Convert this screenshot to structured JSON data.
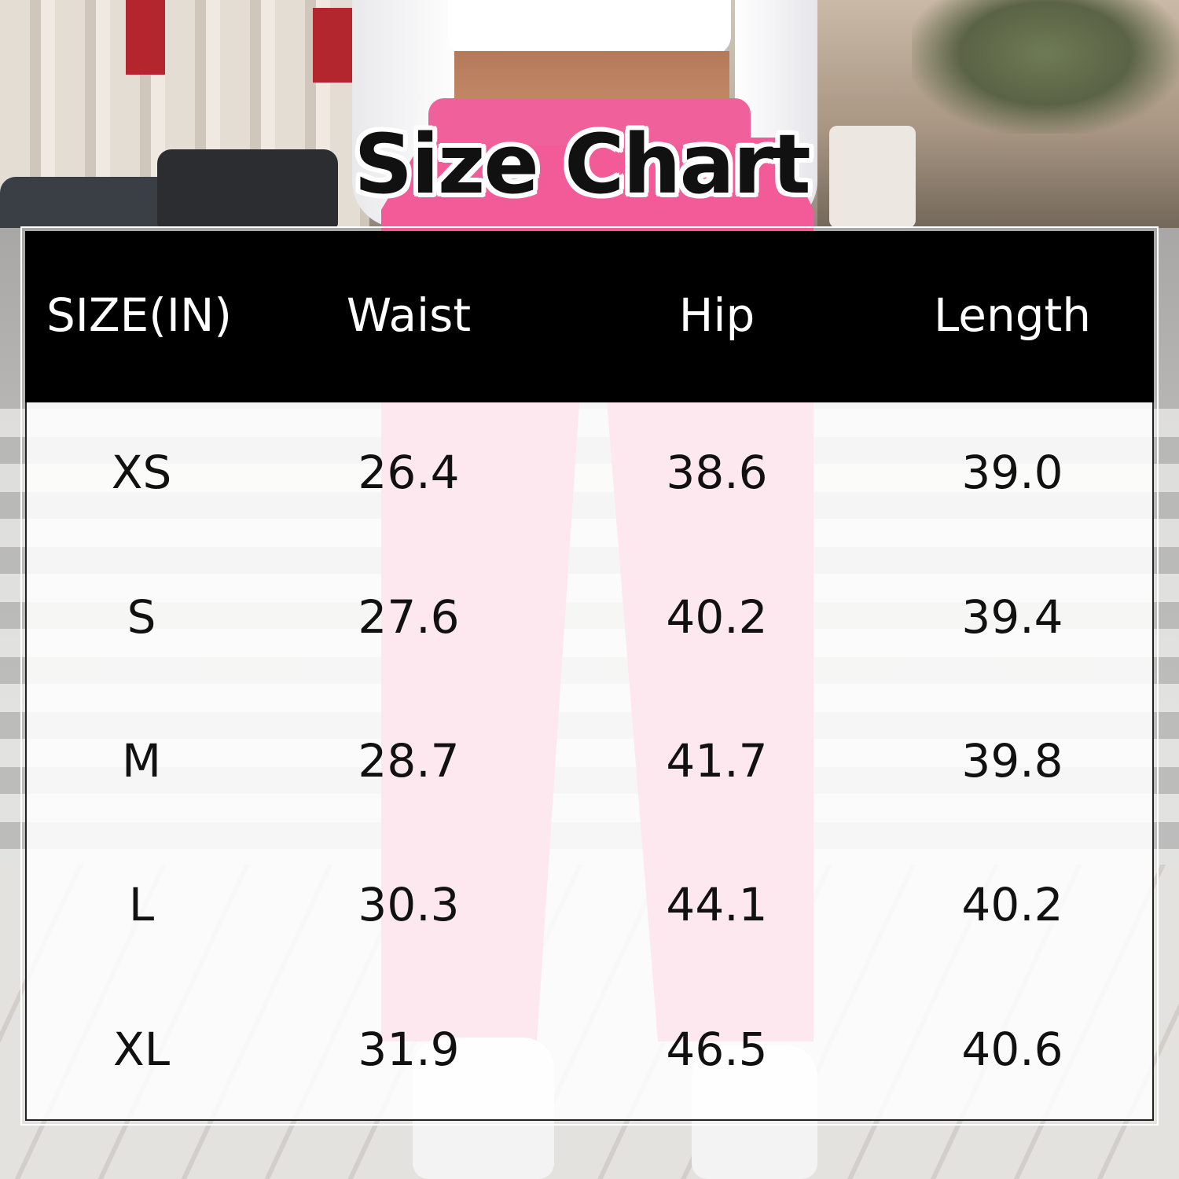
{
  "title": "Size Chart",
  "colors": {
    "header_bg": "#000000",
    "header_text": "#ffffff",
    "body_text": "#111111",
    "pants": "#f25a98"
  },
  "table": {
    "headers": [
      "SIZE(IN)",
      "Waist",
      "Hip",
      "Length"
    ],
    "rows": [
      [
        "XS",
        "26.4",
        "38.6",
        "39.0"
      ],
      [
        "S",
        "27.6",
        "40.2",
        "39.4"
      ],
      [
        "M",
        "28.7",
        "41.7",
        "39.8"
      ],
      [
        "L",
        "30.3",
        "44.1",
        "40.2"
      ],
      [
        "XL",
        "31.9",
        "46.5",
        "40.6"
      ]
    ]
  }
}
